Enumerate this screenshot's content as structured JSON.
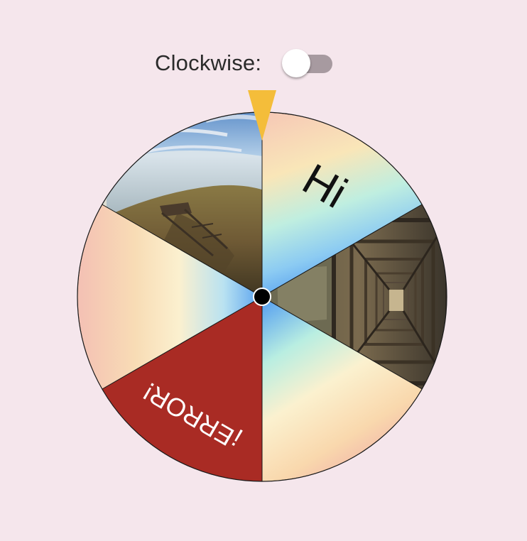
{
  "toggle": {
    "label": "Clockwise:",
    "checked": false
  },
  "wheel": {
    "segments": [
      {
        "kind": "text",
        "label": "Hi",
        "fill": "gradient"
      },
      {
        "kind": "image",
        "label": "",
        "fill": "tunnel-photo"
      },
      {
        "kind": "gradient",
        "label": "",
        "fill": "gradient"
      },
      {
        "kind": "text",
        "label": "¡ERROR!",
        "fill": "#a92b24"
      },
      {
        "kind": "gradient",
        "label": "",
        "fill": "gradient"
      },
      {
        "kind": "image",
        "label": "",
        "fill": "seaside-photo"
      }
    ],
    "pointer_color": "#f4bd3a",
    "hub_color": "#000000",
    "error_color": "#a92b24"
  }
}
